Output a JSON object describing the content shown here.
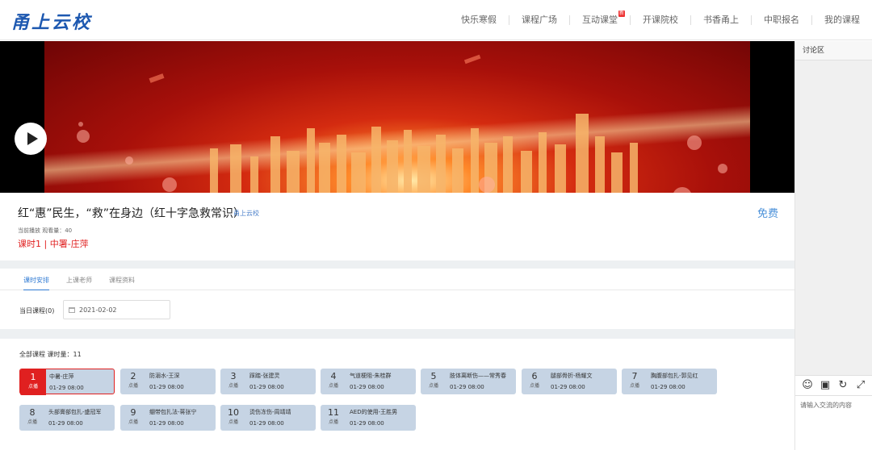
{
  "header": {
    "logo": "甬上云校",
    "nav": [
      {
        "label": "快乐寒假",
        "badge": ""
      },
      {
        "label": "课程广场",
        "badge": ""
      },
      {
        "label": "互动课堂",
        "badge": "新"
      },
      {
        "label": "开课院校",
        "badge": ""
      },
      {
        "label": "书香甬上",
        "badge": ""
      },
      {
        "label": "中职报名",
        "badge": ""
      },
      {
        "label": "我的课程",
        "badge": ""
      }
    ]
  },
  "player": {
    "play_icon": "play-icon"
  },
  "course": {
    "title": "红“惠”民生，“救”在身边（红十字急救常识）",
    "school": "甬上云校",
    "price": "免费",
    "meta": "当前播放 观看量：40",
    "current_lesson": "课时1 | 中署-庄萍"
  },
  "tabs": [
    {
      "label": "课时安排",
      "active": true
    },
    {
      "label": "上课老师",
      "active": false
    },
    {
      "label": "课程资料",
      "active": false
    }
  ],
  "day": {
    "label": "当日课程(0)",
    "date": "2021-02-02"
  },
  "lessons": {
    "summary": "全部课程  课时量：11",
    "items": [
      {
        "num": "1",
        "tag": "点播",
        "name": "中暑-庄萍",
        "time": "01-29 08:00",
        "active": true
      },
      {
        "num": "2",
        "tag": "点播",
        "name": "防溺水-王深",
        "time": "01-29 08:00",
        "active": false
      },
      {
        "num": "3",
        "tag": "点播",
        "name": "踩踏-张建灵",
        "time": "01-29 08:00",
        "active": false
      },
      {
        "num": "4",
        "tag": "点播",
        "name": "气道梗阻-朱桂群",
        "time": "01-29 08:00",
        "active": false
      },
      {
        "num": "5",
        "tag": "点播",
        "name": "肢体离断伤——常秀春",
        "time": "01-29 08:00",
        "active": false
      },
      {
        "num": "6",
        "tag": "点播",
        "name": "腿部骨折-杨耀文",
        "time": "01-29 08:00",
        "active": false
      },
      {
        "num": "7",
        "tag": "点播",
        "name": "胸腹部包扎-郭见红",
        "time": "01-29 08:00",
        "active": false
      },
      {
        "num": "8",
        "tag": "点播",
        "name": "头部膏部包扎-盛冠军",
        "time": "01-29 08:00",
        "active": false
      },
      {
        "num": "9",
        "tag": "点播",
        "name": "绷带包扎法-蒋张宁",
        "time": "01-29 08:00",
        "active": false
      },
      {
        "num": "10",
        "tag": "点播",
        "name": "烫伤冻伤-周靖靖",
        "time": "01-29 08:00",
        "active": false
      },
      {
        "num": "11",
        "tag": "点播",
        "name": "AED的使用-王胜男",
        "time": "01-29 08:00",
        "active": false
      }
    ]
  },
  "discussion": {
    "title": "讨论区",
    "tools": [
      "smiley-icon",
      "image-icon",
      "refresh-icon",
      "fullscreen-icon"
    ],
    "placeholder": "请输入交流的内容"
  }
}
